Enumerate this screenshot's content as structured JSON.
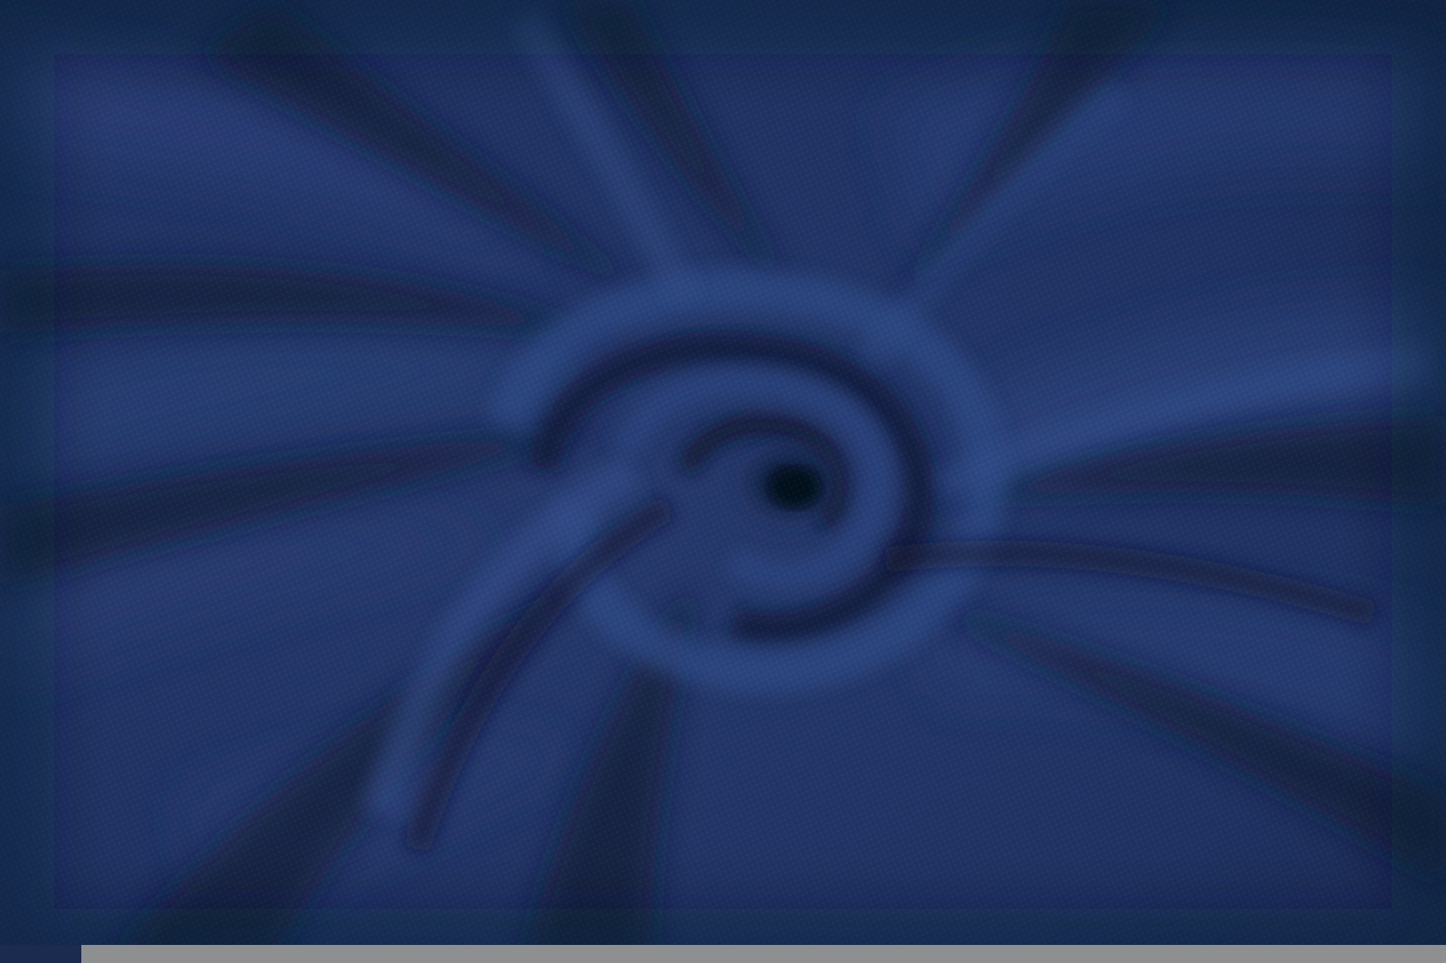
{
  "image": {
    "subject": "fabric-swirl",
    "colors": {
      "base": "#1f3262",
      "highlight": "#2c4680",
      "shadow": "#0e1a36",
      "deep_shadow": "#081226",
      "bottom_strip": "#8e8f91"
    }
  }
}
